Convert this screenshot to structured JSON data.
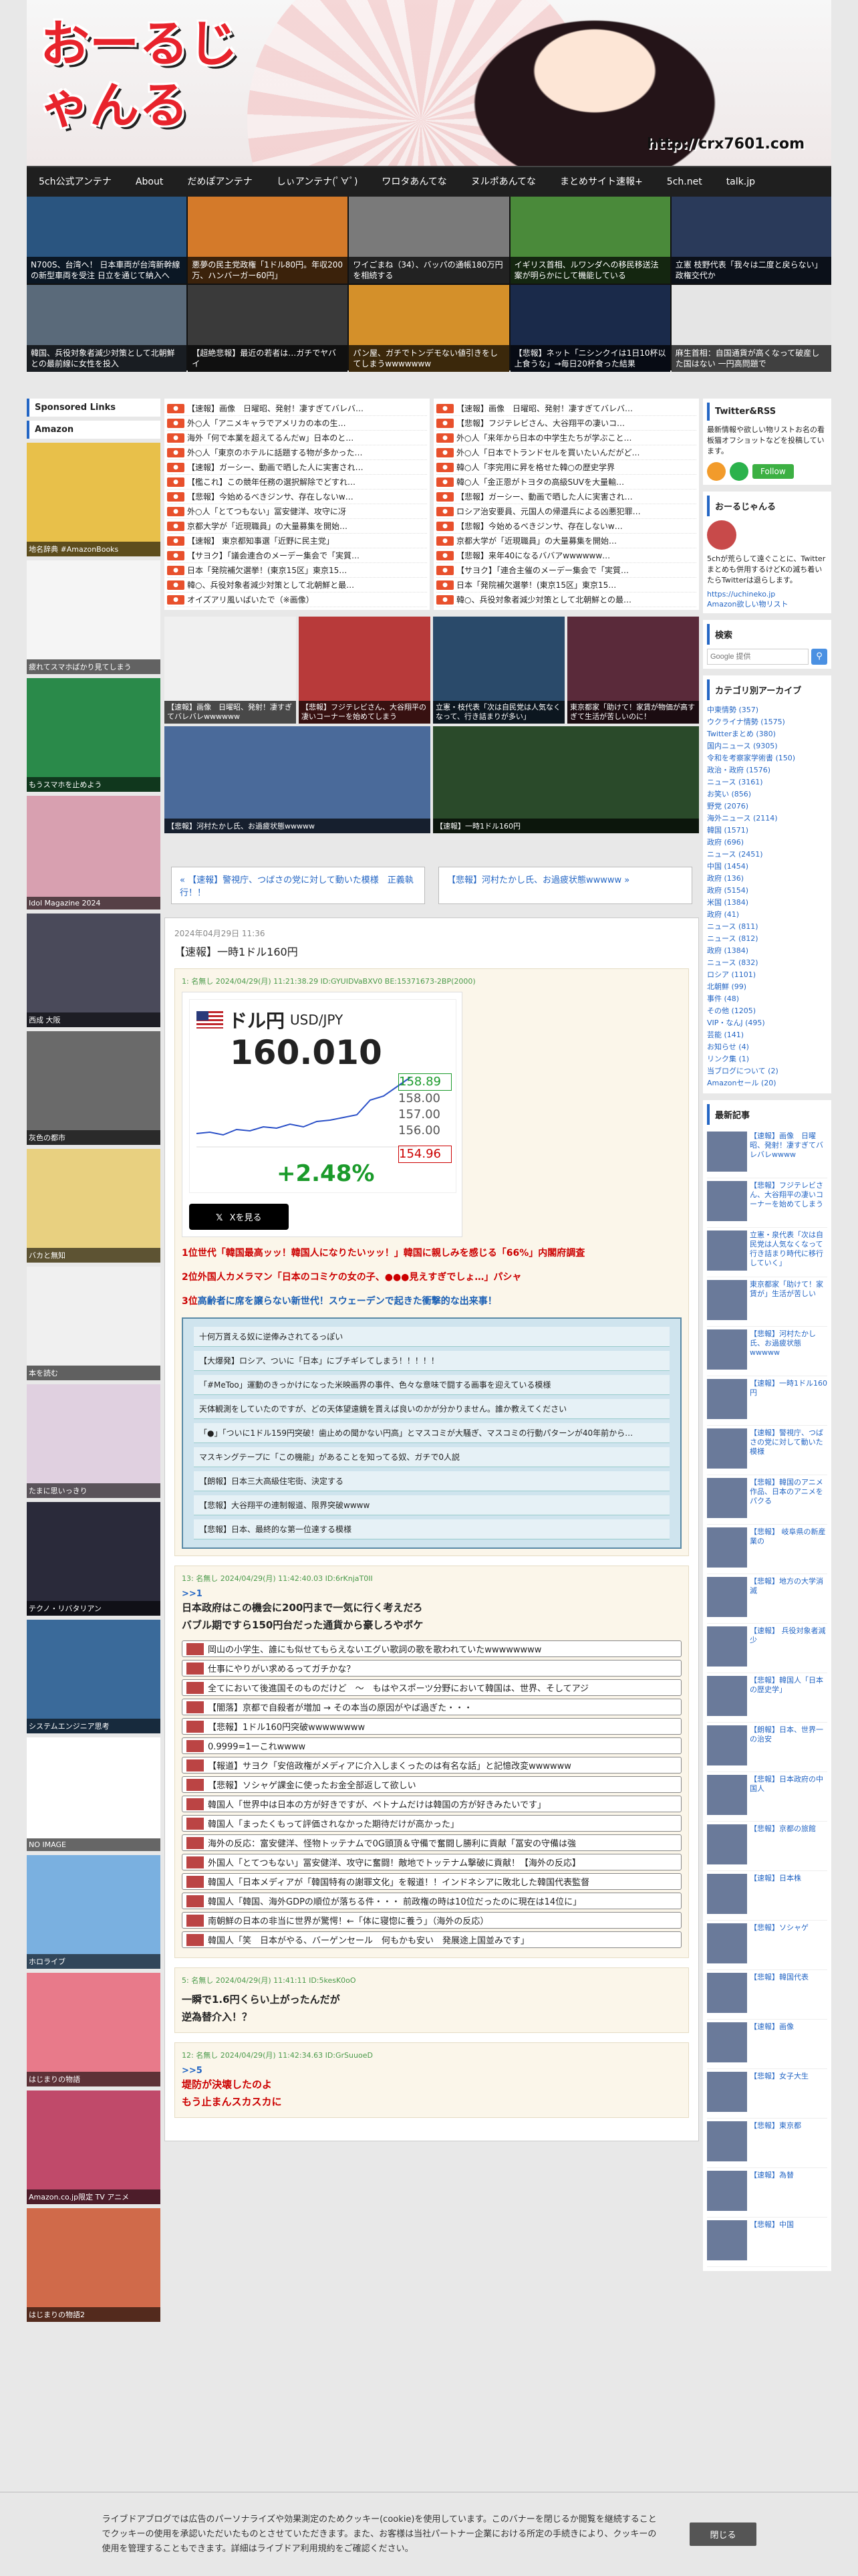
{
  "header": {
    "logo_text": "おーるじゃんる",
    "url_text": "http://crx7601.com"
  },
  "nav": [
    "5ch公式アンテナ",
    "About",
    "だめぽアンテナ",
    "しぃアンテナ(ﾟ∀ﾟ)",
    "ワロタあんてな",
    "ヌルポあんてな",
    "まとめサイト速報+",
    "5ch.net",
    "talk.jp"
  ],
  "thumbs": [
    {
      "cap": "N700S、台湾へ！ 日本車両が台湾新幹線の新型車両を受注 日立を通じて納入へ",
      "color": "#2a5580"
    },
    {
      "cap": "悪夢の民主党政権「1ドル80円。年収200万、ハンバーガー60円」",
      "color": "#d47a2a"
    },
    {
      "cap": "ワイごまね（34）、バッパの通帳180万円を相続する",
      "color": "#7a7a7a"
    },
    {
      "cap": "イギリス首相、ルワンダへの移民移送法案が明らかにして機能している",
      "color": "#4a8a3a"
    },
    {
      "cap": "立憲 枝野代表「我々は二度と戻らない」政権交代か",
      "color": "#2a3a5a"
    },
    {
      "cap": "韓国、兵役対象者減少対策として北朝鮮との最前線に女性を投入",
      "color": "#5a6a7a"
    },
    {
      "cap": "【超絶悲報】最近の若者は…ガチでヤバイ",
      "color": "#3a3a3a"
    },
    {
      "cap": "パン屋、ガチでトンデモない値引きをしてしまうwwwwwww",
      "color": "#d4902a"
    },
    {
      "cap": "【悲報】ネット「ニシンクイは1日10杯以上食うな」→毎日20杯食った結果",
      "color": "#1a2a4a"
    },
    {
      "cap": "麻生首相：自国通貨が高くなって破産した国はない 一円高問題で",
      "color": "#e5e5e5"
    }
  ],
  "left": {
    "sponsored": "Sponsored Links",
    "amazon": "Amazon",
    "items": [
      {
        "cap": "地名辞典 #AmazonBooks",
        "color": "#e8c04a"
      },
      {
        "cap": "疲れてスマホばかり見てしまう",
        "color": "#f5f5f5"
      },
      {
        "cap": "もうスマホを止めよう",
        "color": "#2a8a4a"
      },
      {
        "cap": "Idol Magazine 2024",
        "color": "#d8a0b0"
      },
      {
        "cap": "西成 大阪",
        "color": "#4a4a5a"
      },
      {
        "cap": "灰色の都市",
        "color": "#6a6a6a"
      },
      {
        "cap": "バカと無知",
        "color": "#e8d080"
      },
      {
        "cap": "本を読む",
        "color": "#f0f0f0"
      },
      {
        "cap": "たまに思いっきり",
        "color": "#e0d0e0"
      },
      {
        "cap": "テクノ・リバタリアン",
        "color": "#2a2a3a"
      },
      {
        "cap": "システムエンジニア思考",
        "color": "#3a6a9a"
      },
      {
        "cap": "NO IMAGE",
        "color": "#ffffff"
      },
      {
        "cap": "ホロライブ",
        "color": "#7ab0e0"
      },
      {
        "cap": "はじまりの物語",
        "color": "#e87a8a"
      },
      {
        "cap": "Amazon.co.jp限定 TV アニメ",
        "color": "#c04a6a"
      },
      {
        "cap": "はじまりの物語2",
        "color": "#d06a4a"
      }
    ]
  },
  "rss": {
    "left": [
      "【速報】画像　日曜昭、発射！凄すぎてバレバ…",
      "外○人「アニメキャラでアメリカの本の生…",
      "海外「何で本業を超えてるんだw」日本のと…",
      "外○人「東京のホテルに話題する物が多かった…",
      "【速報】ガーシー、動画で晒した人に実害され…",
      "【檻これ】この競年任務の選択解除でどすれ…",
      "【悲報】今始めるべきジンサ、存在しないw…",
      "外○人「とてつもない」冨安健洋、攻守に冴",
      "京都大学が「近現職員」の大量募集を開始…",
      "【速報】 東京都知事選「近野に民主党」",
      "【サヨク】「議会連合のメーデー集会で「実質…",
      "日本「発院補欠選挙！(東京15区」東京15…",
      "韓○、兵役対象者減少対策として北朝鮮と最…",
      "オイズアリ風いばいたで（※画像）"
    ],
    "right": [
      "【速報】画像　日曜昭、発射！凄すぎてバレバ…",
      "【悲報】フジテレビさん、大谷翔平の凄いコ…",
      "外○人「来年から日本の中学生たちが学ぶこと…",
      "外○人「日本でトランドセルを買いたいんだがど…",
      "韓○人「李完用に昇を格せた韓○の歴史学界",
      "韓○人「金正恩がトヨタの高級SUVを大量輸…",
      "【悲報】ガーシー、動画で晒した人に実害され…",
      "ロシア治安要員、元国人の帰還兵による凶悪犯罪…",
      "【悲報】今始めるべきジンサ、存在しないw…",
      "京都大学が「近現職員」の大量募集を開始…",
      "【悲報】来年40になるババアwwwwww…",
      "【サヨク】「連合主催のメーデー集会で「実質…",
      "日本「発院補欠選挙！(東京15区」東京15…",
      "韓○、兵役対象者減少対策として北朝鮮との最…"
    ]
  },
  "pics": [
    {
      "cap": "【速報】画像　日曜昭、発射！凄すぎてバレバレwwwwww",
      "color": "#f0f0f0"
    },
    {
      "cap": "【悲報】フジテレビさん、大谷翔平の凄いコーナーを始めてしまう",
      "color": "#b83a3a"
    },
    {
      "cap": "立憲・枝代表「次は自民党は人気なくなって、行き詰まりが多い」",
      "color": "#2a4a6a"
    },
    {
      "cap": "東京都家「助けて！家賃が物価が高すぎて生活が苦しいのに！",
      "color": "#5a2a3a"
    }
  ],
  "pics2": [
    {
      "cap": "【悲報】河村たかし氏、お過疲状態wwwww",
      "color": "#4a6a9a"
    },
    {
      "cap": "【速報】一時1ドル160円",
      "color": "#2a4a2a"
    }
  ],
  "pagenav": {
    "prev": "« 【速報】警視庁、つばさの党に対して動いた模様　正義執行！！",
    "next": "【悲報】河村たかし氏、お過疲状態wwwww »"
  },
  "article": {
    "date": "2024年04月29日 11:36",
    "title": "【速報】一時1ドル160円",
    "post1_meta": "1: 名無し 2024/04/29(月) 11:21:38.29 ID:GYUIDVaBXV0 BE:15371673-2BP(2000)",
    "fx": {
      "label": "ドル円",
      "pair": "USD/JPY",
      "value": "160.010",
      "change": "+2.48%",
      "levels": [
        "158.89",
        "158.00",
        "157.00",
        "156.00",
        "154.96"
      ]
    },
    "x_button": "Xを見る",
    "ranks": [
      {
        "n": "1位",
        "t": "世代「韓国最高ッッ！韓国人になりたいッッ！」韓国に親しみを感じる「66%」内閣府調査"
      },
      {
        "n": "2位",
        "t": "外国人カメラマン「日本のコミケの女の子、●●●見えすぎでしょ…」パシャ"
      },
      {
        "n": "3位",
        "t": "高齢者に席を譲らない新世代！スウェーデンで起きた衝撃的な出来事！"
      }
    ],
    "links": [
      "十何万貰える奴に逆俸みされてるっぽい",
      "【大爆発】ロシア、ついに「日本」にブチギレてしまう！！！！！",
      "「#MeToo」運動のきっかけになった米映画界の事件、色々な意味で闘する画事を迎えている模様",
      "天体観測をしていたのですが、どの天体望遠鏡を貰えば良いのかが分かりません。誰か教えてください",
      "「●」「ついに1ドル159円突破！歯止めの聞かない円高」とマスコミが大騒ぎ、マスコミの行動パターンが40年前から…",
      "マスキングテープに「この機能」があることを知ってる奴、ガチで0人説",
      "【朗報】日本三大高級住宅街、決定する",
      "【悲報】大谷翔平の連制報道、限界突破wwww",
      "【悲報】日本、最終的な第一位達する模様"
    ],
    "post2_meta": "13: 名無し 2024/04/29(月) 11:42:40.03 ID:6rKnjaT0II",
    "post2_anchor": ">>1",
    "post2_body": [
      "日本政府はこの機会に200円まで一気に行く考えだろ",
      "バブル期ですら150円台だった通貨から豪しろやボケ"
    ],
    "list2": [
      "岡山の小学生、誰にも似せてもらえないエグい歌詞の歌を歌われていたwwwwwwww",
      "仕事にやりがい求めるってガチかな？",
      "全てにおいて後進国そのものだけど　～　もはやスポーツ分野において韓国は、世界、そしてアジ",
      "【闇落】京都で自殺者が増加 → その本当の原因がやば過ぎた・・・",
      "【悲報】1ドル160円突破wwwwwwww",
      "0.9999=1ーこれwwww",
      "【報道】サヨク「安倍政権がメディアに介入しまくったのは有名な話」と記憶改変wwwwww",
      "【悲報】ソシャゲ課金に使ったお金全部返して欲しい",
      "韓国人「世界中は日本の方が好きですが、ベトナムだけは韓国の方が好きみたいです」",
      "韓国人「まったくもって評価されなかった期待だけが高かった」",
      "海外の反応：富安健洋、怪物トッテナムで0G頭頂＆守備で奮闘し勝利に貢献「冨安の守備は強",
      "外国人「とてつもない」冨安健洋、攻守に奮闘！敵地でトッテナム撃破に貢献！【海外の反応】",
      "韓国人「日本メディアが「韓国特有の謝罪文化」を報道！！インドネシアに敗北した韓国代表監督",
      "韓国人「韓国、海外GDPの順位が落ちる件・・・ 前政権の時は10位だったのに現在は14位に」",
      "南朝鮮の日本の非当に世界が驚愕！←「体に寝惚に養う」（海外の反応）",
      "韓国人「笑　日本がやる、バーゲンセール　何もかも安い　発展途上国並みです」"
    ],
    "post3_meta": "5: 名無し 2024/04/29(月) 11:41:11 ID:5kesK0oO",
    "post3_body": [
      "一瞬で1.6円くらい上がったんだが",
      "逆為替介入！？"
    ],
    "post4_meta": "12: 名無し 2024/04/29(月) 11:42:34.63 ID:GrSuuoeD",
    "post4_anchor": ">>5",
    "post4_body": [
      "堤防が決壊したのよ",
      "もう止まんスカスカに"
    ]
  },
  "right": {
    "twitter_head": "Twitter&RSS",
    "twitter_text": "最新情報や欲しい物リストお名の看板猫オフショットなどを投稿しています。",
    "follow": "Follow",
    "about_head": "おーるじゃんる",
    "about_text": "5chが荒らして遠ぐことに、Twitterまとめも併用するけどKの滅ち着いたらTwitterは退らします。",
    "about_url": "https://uchineko.jp",
    "about_link": "Amazon欲しい物リスト",
    "search_head": "検索",
    "search_placeholder": "Google 提供",
    "cat_head": "カテゴリ別アーカイブ",
    "cats": [
      "中東情勢 (357)",
      "ウクライナ情勢 (1575)",
      "Twitterまとめ (380)",
      "国内ニュース (9305)",
      "令和を考察家学術書 (150)",
      "政治・政府 (1576)",
      "ニュース (3161)",
      "お笑い (856)",
      "野党 (2076)",
      "海外ニュース (2114)",
      "韓国 (1571)",
      "政府 (696)",
      "ニュース (2451)",
      "中国 (1454)",
      "政府 (136)",
      "政府 (5154)",
      "米国 (1384)",
      "政府 (41)",
      "ニュース (811)",
      "ニュース (812)",
      "政府 (1384)",
      "ニュース (832)",
      "ロシア (1101)",
      "北朝鮮 (99)",
      "事件 (48)",
      "その他 (1205)",
      "VIP・なんJ (495)",
      "芸能 (141)",
      "お知らせ (4)",
      "リンク集 (1)",
      "当ブログについて (2)",
      "Amazonセール (20)"
    ],
    "recent_head": "最新記事",
    "recent": [
      "【速報】画像　日曜昭、発射！凄すぎてバレバレwwww",
      "【悲報】フジテレビさん、大谷翔平の凄いコーナーを始めてしまう",
      "立憲・泉代表「次は自民党は人気なくなって行き詰まり時代に移行していく」",
      "東京都家「助けて！家賃が」生活が苦しい",
      "【悲報】河村たかし氏、お過疲状態wwwww",
      "【速報】一時1ドル160円",
      "【速報】警視庁、つばさの党に対して動いた模様",
      "【悲報】韓国のアニメ作品、日本のアニメをパクる",
      "【悲報】 岐阜県の新産業の",
      "【悲報】地方の大学消滅",
      "【速報】 兵役対象者減少",
      "【悲報】韓国人「日本の歴史学」",
      "【朗報】日本、世界一の治安",
      "【悲報】日本政府の中国人",
      "【悲報】京都の旅館",
      "【速報】日本株",
      "【悲報】ソシャゲ",
      "【悲報】韓国代表",
      "【速報】画像",
      "【悲報】女子大生",
      "【悲報】東京都",
      "【速報】為替",
      "【悲報】中国"
    ]
  },
  "cookie": {
    "text": "ライブドアブログでは広告のパーソナライズや効果測定のためクッキー(cookie)を使用しています。このバナーを閉じるか閲覧を継続することでクッキーの使用を承認いただいたものとさせていただきます。また、お客様は当社パートナー企業における所定の手続きにより、クッキーの使用を管理することもできます。詳細はライブドア利用規約をご確認ください。",
    "close": "閉じる"
  }
}
